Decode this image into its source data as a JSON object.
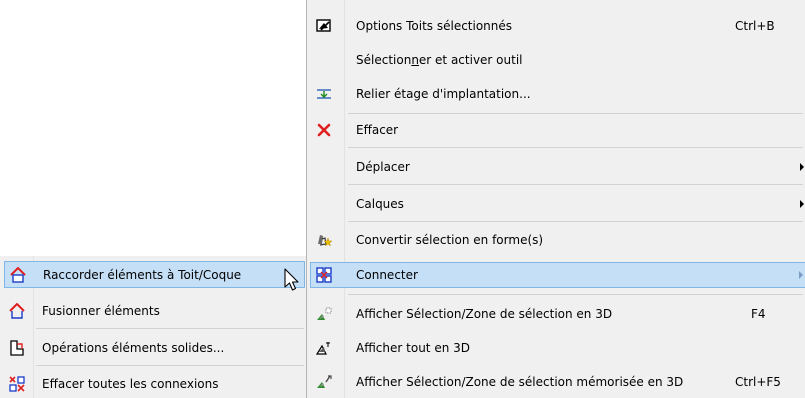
{
  "main_menu": {
    "items": [
      {
        "label": "Options Toits sélectionnés",
        "shortcut": "Ctrl+B",
        "icon": "roof-options-icon"
      },
      {
        "label_parts": [
          "Sélection",
          "n",
          "er et activer outil"
        ],
        "icon": null
      },
      {
        "label": "Relier étage d'implantation...",
        "icon": "link-floor-icon"
      },
      {
        "label": "Effacer",
        "icon": "delete-x-icon",
        "icon_color": "#e02020"
      },
      {
        "label": "Déplacer",
        "submenu": true
      },
      {
        "label": "Calques",
        "submenu": true
      },
      {
        "label": "Convertir sélection en forme(s)",
        "icon": "convert-shape-icon"
      },
      {
        "label": "Connecter",
        "submenu": true,
        "highlighted": true,
        "icon": "connect-icon"
      },
      {
        "label": "Afficher Sélection/Zone de sélection en 3D",
        "shortcut": "F4",
        "icon": "view-3d-selection-icon"
      },
      {
        "label": "Afficher tout en 3D",
        "icon": "view-3d-all-icon"
      },
      {
        "label": "Afficher Sélection/Zone de sélection mémorisée en 3D",
        "shortcut": "Ctrl+F5",
        "icon": "view-3d-memorized-icon"
      }
    ]
  },
  "sub_menu": {
    "items": [
      {
        "label": "Raccorder éléments à Toit/Coque",
        "highlighted": true,
        "icon": "connect-roof-icon"
      },
      {
        "label": "Fusionner éléments",
        "icon": "merge-elements-icon"
      },
      {
        "label": "Opérations éléments solides...",
        "icon": "solid-operations-icon"
      },
      {
        "label": "Effacer toutes les connexions",
        "icon": "delete-connections-icon"
      }
    ]
  },
  "colors": {
    "menu_bg": "#f0f0f0",
    "highlight_bg": "#c5dff7",
    "highlight_border": "#7fb6e6",
    "accent_red": "#e02020"
  }
}
